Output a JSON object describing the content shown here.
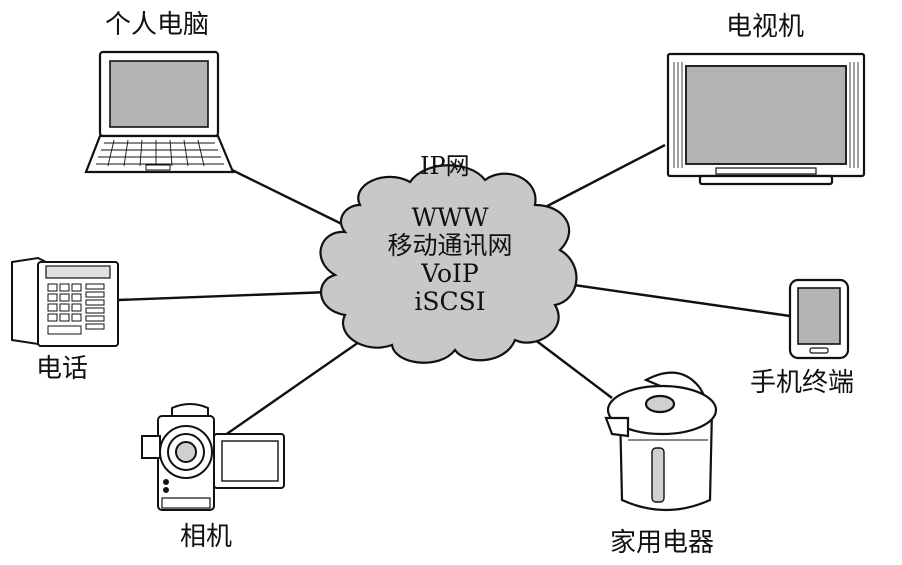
{
  "network": {
    "title": "IP网",
    "services": [
      "WWW",
      "移动通讯网",
      "VoIP",
      "iSCSI"
    ]
  },
  "devices": {
    "laptop": "个人电脑",
    "tv": "电视机",
    "phone": "电话",
    "mobile": "手机终端",
    "camera": "相机",
    "appliance": "家用电器"
  },
  "colors": {
    "cloud_fill": "#c8c8c8",
    "screen_fill": "#b3b3b3",
    "line": "#111111"
  }
}
